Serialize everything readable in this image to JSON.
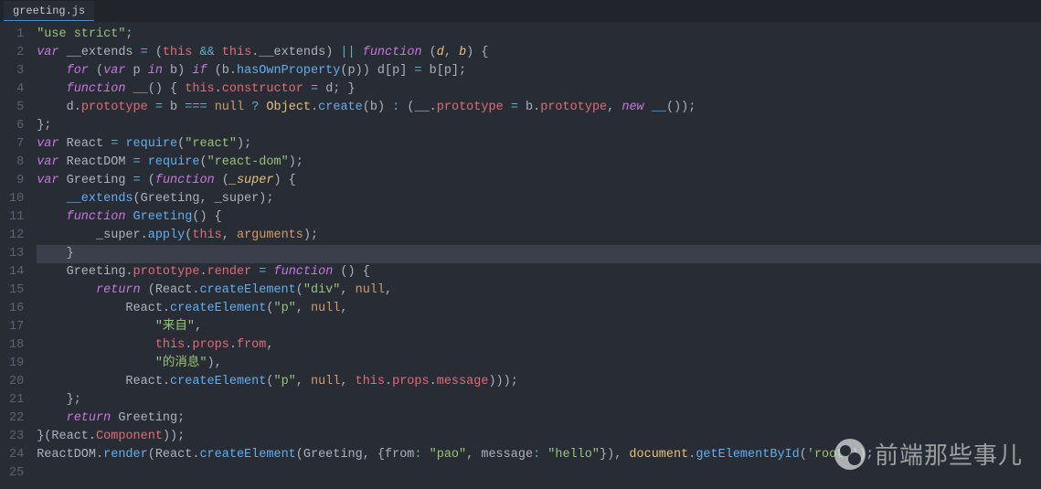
{
  "tab": {
    "filename": "greeting.js"
  },
  "gutter": {
    "start": 1,
    "end": 25
  },
  "highlighted_line": 13,
  "code": {
    "lines": [
      [
        [
          "c-str",
          "\"use strict\""
        ],
        [
          "c-punct",
          ";"
        ]
      ],
      [
        [
          "c-kw",
          "var"
        ],
        [
          "c-plain",
          " __extends "
        ],
        [
          "c-op",
          "="
        ],
        [
          "c-plain",
          " ("
        ],
        [
          "c-this",
          "this"
        ],
        [
          "c-plain",
          " "
        ],
        [
          "c-op",
          "&&"
        ],
        [
          "c-plain",
          " "
        ],
        [
          "c-this",
          "this"
        ],
        [
          "c-punct",
          "."
        ],
        [
          "c-plain",
          "__extends) "
        ],
        [
          "c-op",
          "||"
        ],
        [
          "c-plain",
          " "
        ],
        [
          "c-kw",
          "function"
        ],
        [
          "c-plain",
          " ("
        ],
        [
          "c-param",
          "d"
        ],
        [
          "c-punct",
          ", "
        ],
        [
          "c-param",
          "b"
        ],
        [
          "c-plain",
          ") {"
        ]
      ],
      [
        [
          "c-plain",
          "    "
        ],
        [
          "c-kw",
          "for"
        ],
        [
          "c-plain",
          " ("
        ],
        [
          "c-kw",
          "var"
        ],
        [
          "c-plain",
          " p "
        ],
        [
          "c-kw",
          "in"
        ],
        [
          "c-plain",
          " b) "
        ],
        [
          "c-kw",
          "if"
        ],
        [
          "c-plain",
          " (b."
        ],
        [
          "c-fn",
          "hasOwnProperty"
        ],
        [
          "c-plain",
          "(p)) d[p] "
        ],
        [
          "c-op",
          "="
        ],
        [
          "c-plain",
          " b[p];"
        ]
      ],
      [
        [
          "c-plain",
          "    "
        ],
        [
          "c-kw",
          "function"
        ],
        [
          "c-plain",
          " "
        ],
        [
          "c-fn",
          "__"
        ],
        [
          "c-plain",
          "() { "
        ],
        [
          "c-this",
          "this"
        ],
        [
          "c-punct",
          "."
        ],
        [
          "c-prop",
          "constructor"
        ],
        [
          "c-plain",
          " "
        ],
        [
          "c-op",
          "="
        ],
        [
          "c-plain",
          " d; }"
        ]
      ],
      [
        [
          "c-plain",
          "    d."
        ],
        [
          "c-prop",
          "prototype"
        ],
        [
          "c-plain",
          " "
        ],
        [
          "c-op",
          "="
        ],
        [
          "c-plain",
          " b "
        ],
        [
          "c-op",
          "==="
        ],
        [
          "c-plain",
          " "
        ],
        [
          "c-const",
          "null"
        ],
        [
          "c-plain",
          " "
        ],
        [
          "c-op",
          "?"
        ],
        [
          "c-plain",
          " "
        ],
        [
          "c-obj",
          "Object"
        ],
        [
          "c-punct",
          "."
        ],
        [
          "c-fn",
          "create"
        ],
        [
          "c-plain",
          "(b) "
        ],
        [
          "c-op",
          ":"
        ],
        [
          "c-plain",
          " (__."
        ],
        [
          "c-prop",
          "prototype"
        ],
        [
          "c-plain",
          " "
        ],
        [
          "c-op",
          "="
        ],
        [
          "c-plain",
          " b."
        ],
        [
          "c-prop",
          "prototype"
        ],
        [
          "c-punct",
          ", "
        ],
        [
          "c-kw",
          "new"
        ],
        [
          "c-plain",
          " "
        ],
        [
          "c-fn",
          "__"
        ],
        [
          "c-plain",
          "());"
        ]
      ],
      [
        [
          "c-plain",
          "};"
        ]
      ],
      [
        [
          "c-kw",
          "var"
        ],
        [
          "c-plain",
          " React "
        ],
        [
          "c-op",
          "="
        ],
        [
          "c-plain",
          " "
        ],
        [
          "c-fn",
          "require"
        ],
        [
          "c-plain",
          "("
        ],
        [
          "c-str",
          "\"react\""
        ],
        [
          "c-plain",
          ");"
        ]
      ],
      [
        [
          "c-kw",
          "var"
        ],
        [
          "c-plain",
          " ReactDOM "
        ],
        [
          "c-op",
          "="
        ],
        [
          "c-plain",
          " "
        ],
        [
          "c-fn",
          "require"
        ],
        [
          "c-plain",
          "("
        ],
        [
          "c-str",
          "\"react-dom\""
        ],
        [
          "c-plain",
          ");"
        ]
      ],
      [
        [
          "c-kw",
          "var"
        ],
        [
          "c-plain",
          " Greeting "
        ],
        [
          "c-op",
          "="
        ],
        [
          "c-plain",
          " ("
        ],
        [
          "c-kw",
          "function"
        ],
        [
          "c-plain",
          " ("
        ],
        [
          "c-param",
          "_super"
        ],
        [
          "c-plain",
          ") {"
        ]
      ],
      [
        [
          "c-plain",
          "    "
        ],
        [
          "c-fn",
          "__extends"
        ],
        [
          "c-plain",
          "(Greeting, _super);"
        ]
      ],
      [
        [
          "c-plain",
          "    "
        ],
        [
          "c-kw",
          "function"
        ],
        [
          "c-plain",
          " "
        ],
        [
          "c-fn",
          "Greeting"
        ],
        [
          "c-plain",
          "() {"
        ]
      ],
      [
        [
          "c-plain",
          "        _super."
        ],
        [
          "c-fn",
          "apply"
        ],
        [
          "c-plain",
          "("
        ],
        [
          "c-this",
          "this"
        ],
        [
          "c-punct",
          ", "
        ],
        [
          "c-const",
          "arguments"
        ],
        [
          "c-plain",
          ");"
        ]
      ],
      [
        [
          "c-plain",
          "    }"
        ]
      ],
      [
        [
          "c-plain",
          "    Greeting."
        ],
        [
          "c-prop",
          "prototype"
        ],
        [
          "c-punct",
          "."
        ],
        [
          "c-prop",
          "render"
        ],
        [
          "c-plain",
          " "
        ],
        [
          "c-op",
          "="
        ],
        [
          "c-plain",
          " "
        ],
        [
          "c-kw",
          "function"
        ],
        [
          "c-plain",
          " () {"
        ]
      ],
      [
        [
          "c-plain",
          "        "
        ],
        [
          "c-kw",
          "return"
        ],
        [
          "c-plain",
          " (React."
        ],
        [
          "c-fn",
          "createElement"
        ],
        [
          "c-plain",
          "("
        ],
        [
          "c-str",
          "\"div\""
        ],
        [
          "c-punct",
          ", "
        ],
        [
          "c-const",
          "null"
        ],
        [
          "c-punct",
          ", "
        ]
      ],
      [
        [
          "c-plain",
          "            React."
        ],
        [
          "c-fn",
          "createElement"
        ],
        [
          "c-plain",
          "("
        ],
        [
          "c-str",
          "\"p\""
        ],
        [
          "c-punct",
          ", "
        ],
        [
          "c-const",
          "null"
        ],
        [
          "c-punct",
          ", "
        ]
      ],
      [
        [
          "c-plain",
          "                "
        ],
        [
          "c-str",
          "\"来自\""
        ],
        [
          "c-punct",
          ", "
        ]
      ],
      [
        [
          "c-plain",
          "                "
        ],
        [
          "c-this",
          "this"
        ],
        [
          "c-punct",
          "."
        ],
        [
          "c-prop",
          "props"
        ],
        [
          "c-punct",
          "."
        ],
        [
          "c-prop",
          "from"
        ],
        [
          "c-punct",
          ", "
        ]
      ],
      [
        [
          "c-plain",
          "                "
        ],
        [
          "c-str",
          "\"的消息\""
        ],
        [
          "c-plain",
          "), "
        ]
      ],
      [
        [
          "c-plain",
          "            React."
        ],
        [
          "c-fn",
          "createElement"
        ],
        [
          "c-plain",
          "("
        ],
        [
          "c-str",
          "\"p\""
        ],
        [
          "c-punct",
          ", "
        ],
        [
          "c-const",
          "null"
        ],
        [
          "c-punct",
          ", "
        ],
        [
          "c-this",
          "this"
        ],
        [
          "c-punct",
          "."
        ],
        [
          "c-prop",
          "props"
        ],
        [
          "c-punct",
          "."
        ],
        [
          "c-prop",
          "message"
        ],
        [
          "c-plain",
          ")));"
        ]
      ],
      [
        [
          "c-plain",
          "    };"
        ]
      ],
      [
        [
          "c-plain",
          "    "
        ],
        [
          "c-kw",
          "return"
        ],
        [
          "c-plain",
          " Greeting;"
        ]
      ],
      [
        [
          "c-plain",
          "}(React."
        ],
        [
          "c-prop",
          "Component"
        ],
        [
          "c-plain",
          "));"
        ]
      ],
      [
        [
          "c-plain",
          "ReactDOM."
        ],
        [
          "c-fn",
          "render"
        ],
        [
          "c-plain",
          "(React."
        ],
        [
          "c-fn",
          "createElement"
        ],
        [
          "c-plain",
          "(Greeting, {from"
        ],
        [
          "c-op",
          ":"
        ],
        [
          "c-plain",
          " "
        ],
        [
          "c-str",
          "\"pao\""
        ],
        [
          "c-punct",
          ", "
        ],
        [
          "c-plain",
          "message"
        ],
        [
          "c-op",
          ":"
        ],
        [
          "c-plain",
          " "
        ],
        [
          "c-str",
          "\"hello\""
        ],
        [
          "c-plain",
          "}), "
        ],
        [
          "c-obj",
          "document"
        ],
        [
          "c-punct",
          "."
        ],
        [
          "c-fn",
          "getElementById"
        ],
        [
          "c-plain",
          "("
        ],
        [
          "c-str",
          "'root'"
        ],
        [
          "c-plain",
          "));"
        ]
      ],
      [
        [
          "c-plain",
          ""
        ]
      ]
    ]
  },
  "watermark": {
    "text": "前端那些事儿"
  }
}
